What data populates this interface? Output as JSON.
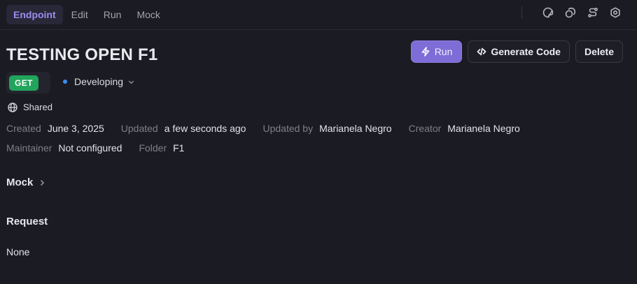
{
  "tabs": [
    {
      "label": "Endpoint",
      "active": true
    },
    {
      "label": "Edit",
      "active": false
    },
    {
      "label": "Run",
      "active": false
    },
    {
      "label": "Mock",
      "active": false
    }
  ],
  "top_icons": [
    "palette-icon",
    "copy-icon",
    "route-icon",
    "settings-icon"
  ],
  "title": "TESTING OPEN F1",
  "actions": {
    "run_label": "Run",
    "generate_code_label": "Generate Code",
    "delete_label": "Delete"
  },
  "method": "GET",
  "status": "Developing",
  "visibility": "Shared",
  "meta": {
    "created_label": "Created",
    "created_value": "June 3, 2025",
    "updated_label": "Updated",
    "updated_value": "a few seconds ago",
    "updated_by_label": "Updated by",
    "updated_by_value": "Marianela Negro",
    "creator_label": "Creator",
    "creator_value": "Marianela Negro",
    "maintainer_label": "Maintainer",
    "maintainer_value": "Not configured",
    "folder_label": "Folder",
    "folder_value": "F1"
  },
  "sections": {
    "mock_label": "Mock",
    "request_label": "Request",
    "request_value": "None"
  },
  "colors": {
    "background": "#1b1b23",
    "accent": "#7e6dd6",
    "method_get": "#22a45c",
    "status_dot": "#3d8ef5"
  }
}
